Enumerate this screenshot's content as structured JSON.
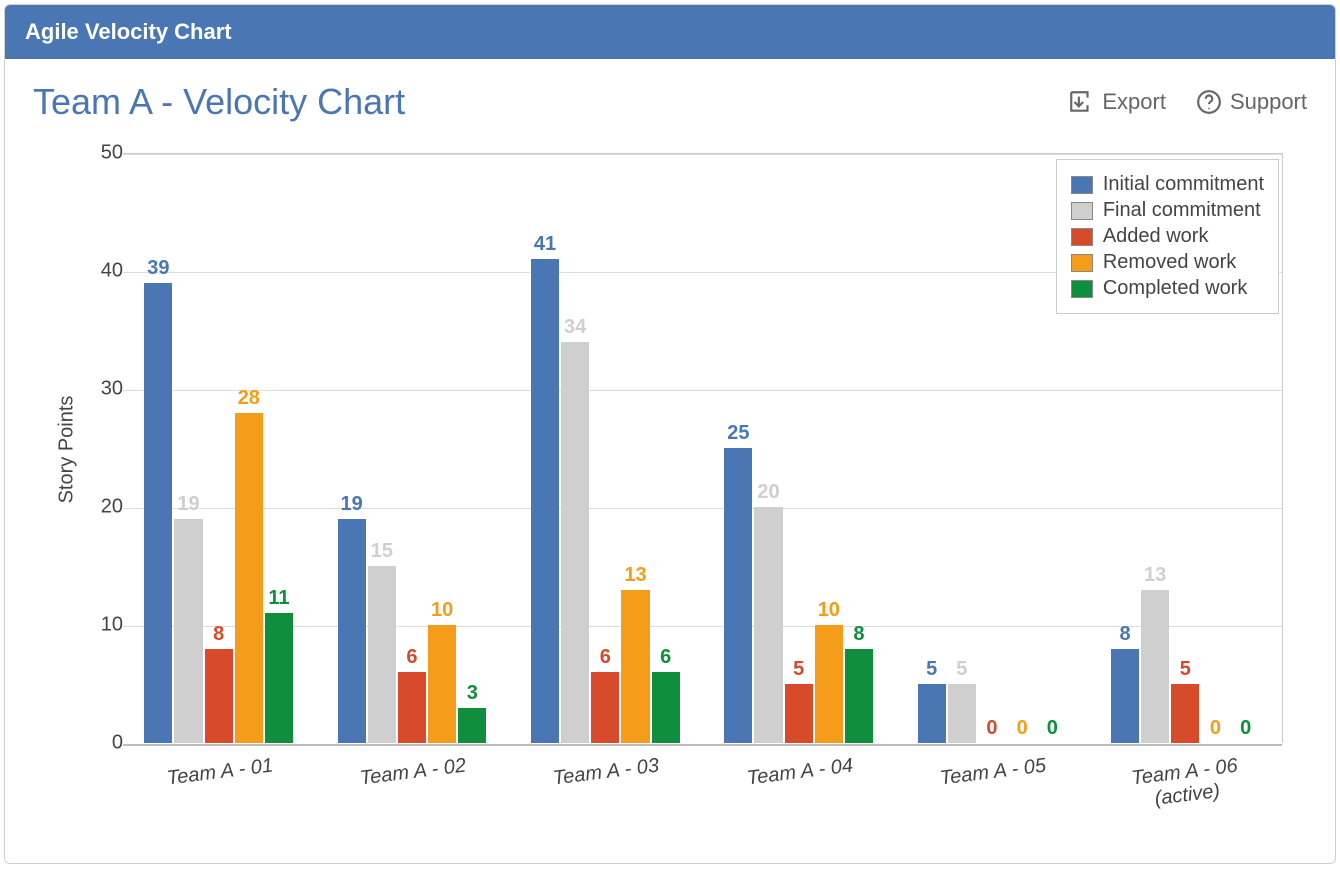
{
  "header": {
    "title": "Agile Velocity Chart"
  },
  "page": {
    "title": "Team A - Velocity Chart"
  },
  "actions": {
    "export": "Export",
    "support": "Support"
  },
  "chart_data": {
    "type": "bar",
    "ylabel": "Story Points",
    "ylim": [
      0,
      50
    ],
    "yticks": [
      0,
      10,
      20,
      30,
      40,
      50
    ],
    "categories": [
      "Team A - 01",
      "Team A - 02",
      "Team A - 03",
      "Team A - 04",
      "Team A - 05",
      "Team A - 06\n(active)"
    ],
    "series": [
      {
        "name": "Initial commitment",
        "color": "#4a77b4",
        "values": [
          39,
          19,
          41,
          25,
          5,
          8
        ]
      },
      {
        "name": "Final commitment",
        "color": "#cfcfcf",
        "values": [
          19,
          15,
          34,
          20,
          5,
          13
        ]
      },
      {
        "name": "Added work",
        "color": "#d84b2a",
        "values": [
          8,
          6,
          6,
          5,
          0,
          5
        ]
      },
      {
        "name": "Removed work",
        "color": "#f59c1a",
        "values": [
          28,
          10,
          13,
          10,
          0,
          0
        ]
      },
      {
        "name": "Completed work",
        "color": "#0f8f3e",
        "values": [
          11,
          3,
          6,
          8,
          0,
          0
        ]
      }
    ],
    "legend_position": "top-right"
  }
}
